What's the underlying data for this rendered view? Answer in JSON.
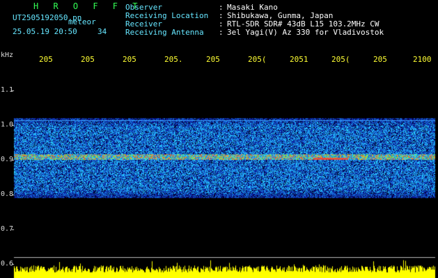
{
  "app": {
    "title": "H R O F F T"
  },
  "file": {
    "name": "UT2505192050.pn",
    "type_label": "meteor",
    "timestamp": "25.05.19 20:50",
    "count": "34"
  },
  "info": {
    "labels": [
      "Observer",
      "Receiving Location",
      "Receiver",
      "Receiving Antenna"
    ],
    "separator": ":",
    "values": [
      "Masaki Kano",
      "Shibukawa, Gunma, Japan",
      "RTL-SDR SDR# 43dB L15 103.2MHz CW",
      "3el Yagi(V) Az 330 for Vladivostok"
    ]
  },
  "axis": {
    "unit": "kHz",
    "time_ticks": [
      "205",
      "205",
      "205",
      "205.",
      "205",
      "205(",
      "2051",
      "205(",
      "205",
      "2100"
    ],
    "freq_ticks": [
      "1.1",
      "1.0",
      "0.9",
      "0.8",
      "0.7",
      "0.6"
    ]
  },
  "colors": {
    "background": "#000000",
    "label_text": "#66e6ff",
    "value_text": "#ffffff",
    "title_text": "#33ff55",
    "time_ticks": "#ffff33",
    "signal_band": "#1a3fd6",
    "carrier_line": "#ff3030",
    "amplitude_bars": "#ffff00"
  },
  "spectrogram": {
    "band_khz": [
      0.79,
      1.02
    ],
    "carrier_khz": 0.91,
    "edge_line_khz": 1.0
  }
}
